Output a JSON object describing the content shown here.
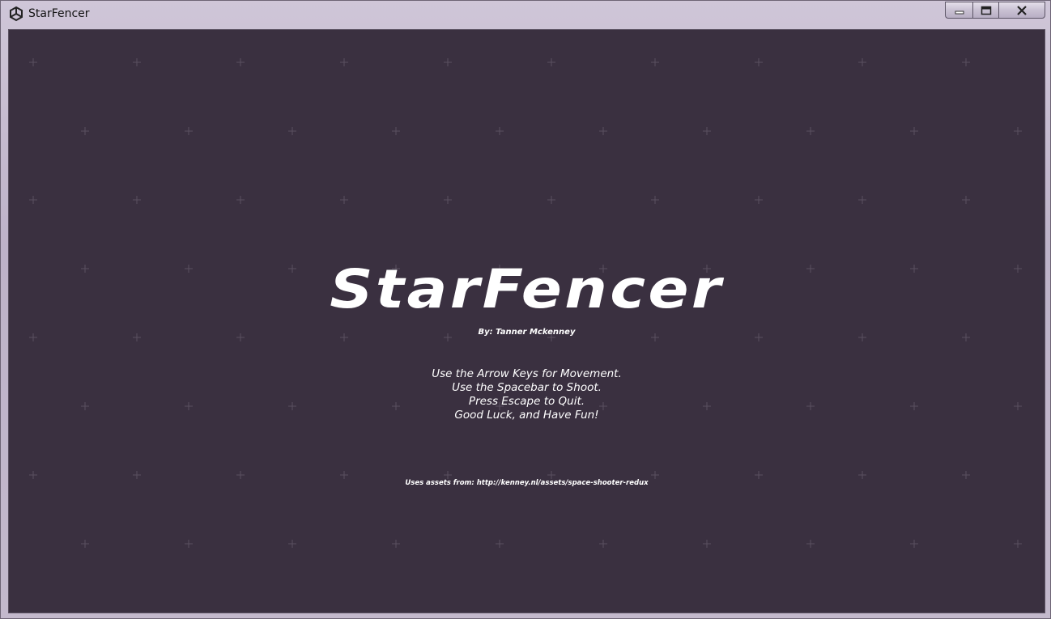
{
  "window": {
    "title": "StarFencer",
    "icon": "unity-icon",
    "buttons": {
      "minimize": "minimize-icon",
      "maximize": "maximize-icon",
      "close": "close-icon"
    }
  },
  "game": {
    "logo": "StarFencer",
    "byline": "By: Tanner Mckenney",
    "instructions": [
      "Use the Arrow Keys for Movement.",
      "Use the Spacebar to Shoot.",
      "Press Escape to Quit.",
      "Good Luck, and Have Fun!"
    ],
    "credits": "Uses assets from: http://kenney.nl/assets/space-shooter-redux",
    "colors": {
      "background": "#3a3040",
      "text": "#ffffff",
      "star": "#5a5060"
    }
  }
}
